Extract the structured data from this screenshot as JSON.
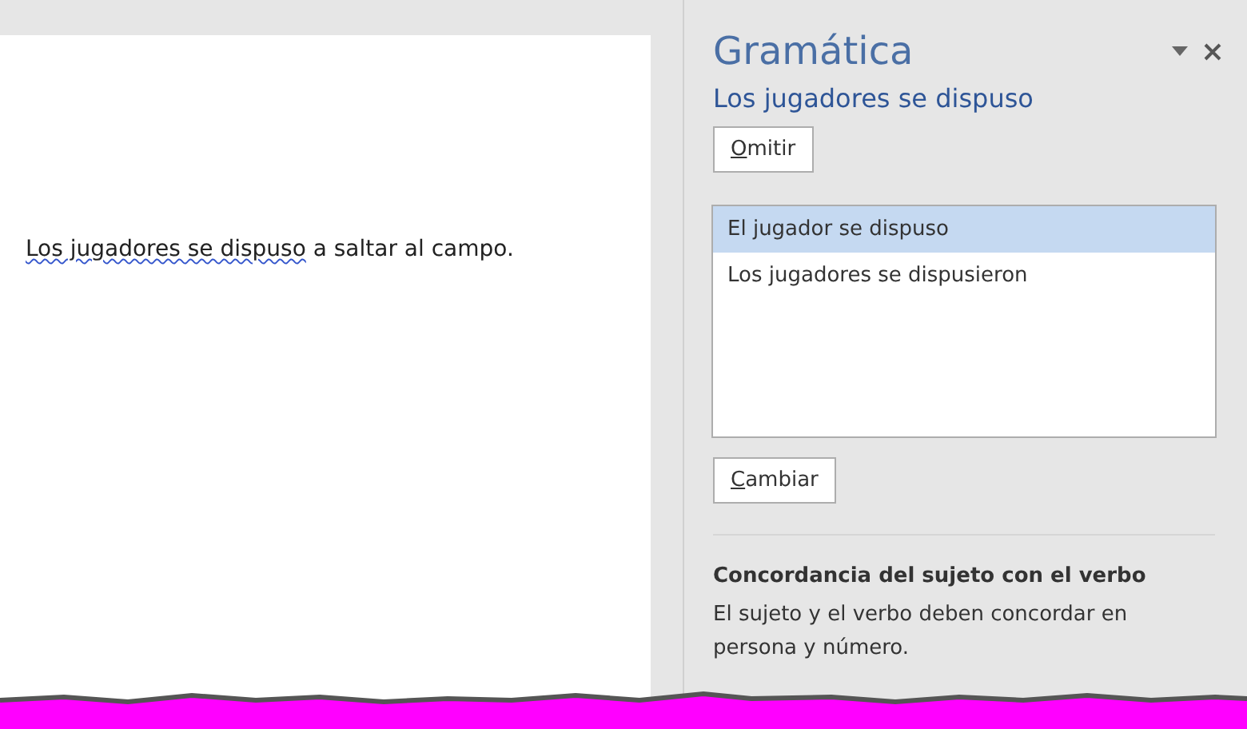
{
  "document": {
    "sentence": [
      {
        "text": "Los jugadores se dispuso",
        "flagged": true
      },
      {
        "text": " a saltar al campo.",
        "flagged": false
      }
    ]
  },
  "pane": {
    "title": "Gramática",
    "error_text": "Los jugadores se dispuso",
    "skip_button": "Omitir",
    "suggestions": [
      {
        "text": "El jugador se dispuso",
        "selected": true
      },
      {
        "text": "Los jugadores se dispusieron",
        "selected": false
      }
    ],
    "change_button": "Cambiar",
    "rule_title": "Concordancia del sujeto con el verbo",
    "rule_text": "El sujeto y el verbo deben concordar en persona y número."
  }
}
